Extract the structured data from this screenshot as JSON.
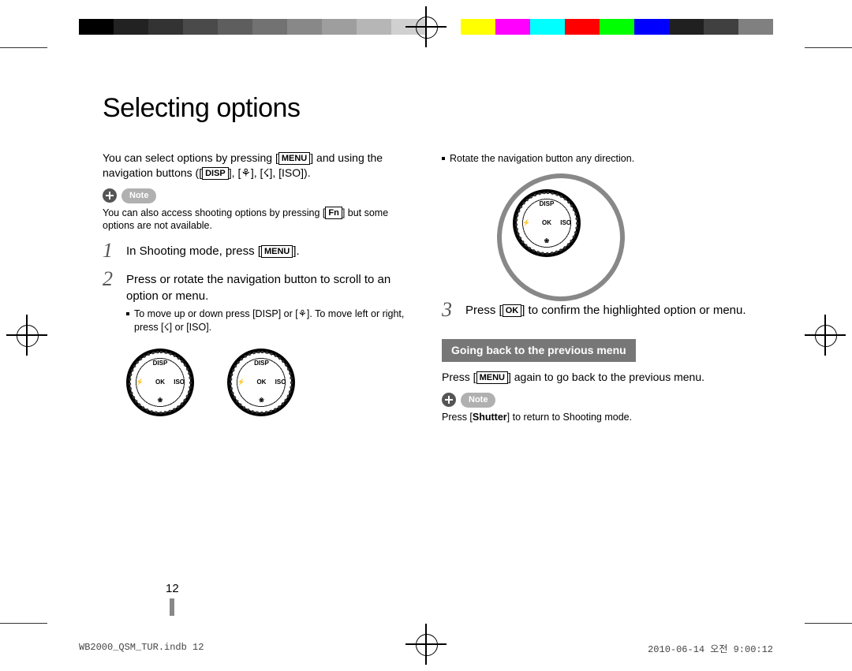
{
  "title": "Selecting options",
  "intro_pre": "You can select options by pressing [",
  "intro_menu": "MENU",
  "intro_mid": "] and using the navigation buttons ([",
  "intro_disp": "DISP",
  "intro_end": "], [⚘], [☇], [ISO]).",
  "note_label": "Note",
  "note1_pre": "You can also access shooting options by pressing [",
  "note1_fn": "Fn",
  "note1_post": "] but some options are not available.",
  "step1_pre": "In Shooting mode, press [",
  "step1_menu": "MENU",
  "step1_post": "].",
  "step2": "Press or rotate the navigation button to scroll to an option or menu.",
  "step2_sub": "To move up or down press [DISP] or [⚘]. To move left or right, press [☇] or [ISO].",
  "right_bullet": "Rotate the navigation button any direction.",
  "step3_pre": "Press [",
  "step3_ok": "OK",
  "step3_post": "] to confirm the highlighted option or menu.",
  "subhead": "Going back to the previous menu",
  "back_pre": "Press [",
  "back_menu": "MENU",
  "back_post": "] again to go back to the previous menu.",
  "note2_pre": "Press [",
  "note2_shutter": "Shutter",
  "note2_post": "] to return to Shooting mode.",
  "pagenum": "12",
  "footer_left": "WB2000_QSM_TUR.indb   12",
  "footer_right": "2010-06-14   오전 9:00:12",
  "swatches": [
    "#000000",
    "#222222",
    "#333333",
    "#4a4a4a",
    "#5e5e5e",
    "#727272",
    "#888888",
    "#9e9e9e",
    "#b6b6b6",
    "#d0d0d0",
    "#ffffff",
    "#FFFF00",
    "#FF00FF",
    "#00FFFF",
    "#FF0000",
    "#00FF00",
    "#0000FF",
    "#202020",
    "#404040",
    "#808080"
  ]
}
